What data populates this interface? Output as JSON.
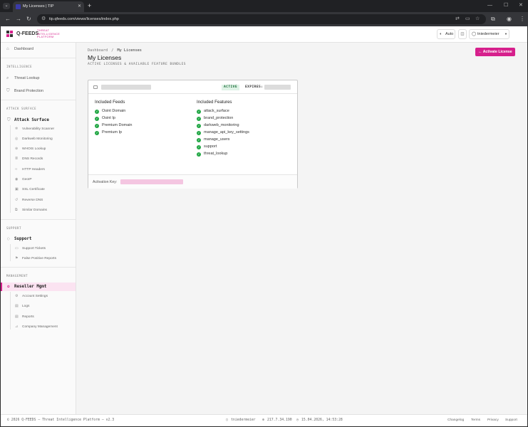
{
  "browser": {
    "tab_title": "My Licenses | TIP",
    "url": "tip.qfeeds.com/views/licenses/index.php"
  },
  "brand": {
    "name": "Q-FEEDS",
    "tagline_1": "THREAT",
    "tagline_2": "INTELLIGENCE",
    "tagline_3": "PLATFORM",
    "accent_color": "#d6208c"
  },
  "topbar": {
    "theme_label": "Auto",
    "user_label": "tniedermeier"
  },
  "sidebar": {
    "dashboard": "Dashboard",
    "sec_intelligence": "INTELLIGENCE",
    "threat_lookup": "Threat Lookup",
    "brand_protection": "Brand Protection",
    "sec_attack": "ATTACK SURFACE",
    "attack_surface": "Attack Surface",
    "attack_items": [
      "Vulnerability Scanner",
      "Darkweb Monitoring",
      "WHOIS Lookup",
      "DNS Records",
      "HTTP Headers",
      "GeoIP",
      "SSL Certificate",
      "Reverse DNS",
      "Similar Domains"
    ],
    "sec_support": "SUPPORT",
    "support": "Support",
    "support_items": [
      "Support Tickets",
      "False Positive Reports"
    ],
    "sec_management": "MANAGEMENT",
    "reseller": "Reseller Mgmt",
    "reseller_items": [
      "Account Settings",
      "Logs",
      "Reports",
      "Company Management"
    ]
  },
  "main": {
    "crumb_root": "Dashboard",
    "crumb_sep": "/",
    "crumb_current": "My Licenses",
    "title": "My Licenses",
    "subtitle": "ACTIVE LICENSES & AVAILABLE FEATURE BUNDLES",
    "activate_button": "← Activate License"
  },
  "license": {
    "status": "ACTIVE",
    "expires_label": "EXPIRES:",
    "feeds_title": "Included Feeds",
    "feeds": [
      "Osint Domain",
      "Osint Ip",
      "Premium Domain",
      "Premium Ip"
    ],
    "features_title": "Included Features",
    "features": [
      "attack_surface",
      "brand_protection",
      "darkweb_monitoring",
      "manage_api_key_settings",
      "manage_users",
      "support",
      "threat_lookup"
    ],
    "activation_key_label": "Activation Key:"
  },
  "footer": {
    "copyright": "© 2026 Q-FEEDS — Threat Intelligence Platform — v2.3",
    "user": "tniedermeier",
    "ip": "217.7.34.190",
    "timestamp": "15.04.2026, 14:53:28",
    "links": [
      "Changelog",
      "Terms",
      "Privacy",
      "Support"
    ]
  }
}
